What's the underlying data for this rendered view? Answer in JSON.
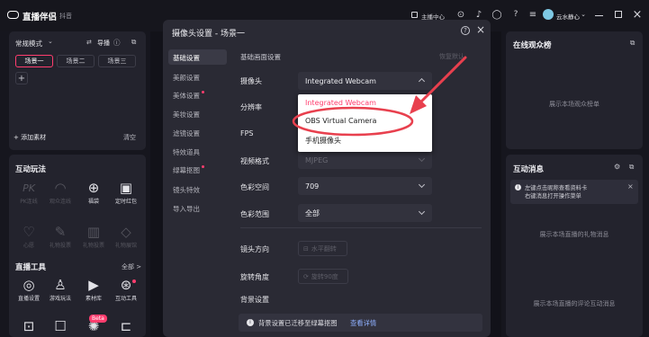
{
  "app": {
    "title": "直播伴侣",
    "subtitle": "抖音"
  },
  "titlebar": {
    "center_label": "主播中心",
    "user": "云水静心",
    "close": "×"
  },
  "left": {
    "mode": "常规模式",
    "guide": "导播",
    "scenes": [
      "场景一",
      "场景二",
      "场景三"
    ],
    "add": "+",
    "add_material": "+ 添加素材",
    "clear": "清空",
    "interactive_title": "互动玩法",
    "interactive": [
      {
        "label": "PK连线",
        "icon": "PK",
        "enabled": false
      },
      {
        "label": "观众连线",
        "icon": "◠",
        "enabled": false
      },
      {
        "label": "福袋",
        "icon": "⊕",
        "enabled": true
      },
      {
        "label": "定时红包",
        "icon": "▣",
        "enabled": true
      },
      {
        "label": "心愿",
        "icon": "♡",
        "enabled": false
      },
      {
        "label": "礼物投票",
        "icon": "✎",
        "enabled": false
      },
      {
        "label": "礼物投票",
        "icon": "▥",
        "enabled": false
      },
      {
        "label": "礼物展馆",
        "icon": "◇",
        "enabled": false
      }
    ],
    "tools_title": "直播工具",
    "tools_all": "全部 >",
    "tools": [
      {
        "label": "直播设置",
        "icon": "◎"
      },
      {
        "label": "游戏玩法",
        "icon": "♙"
      },
      {
        "label": "素材库",
        "icon": "▶"
      },
      {
        "label": "互动工具",
        "icon": "⊛"
      }
    ],
    "more_tools": [
      {
        "icon": "⊡"
      },
      {
        "icon": "☐"
      },
      {
        "icon": "✺",
        "badge": "Beta"
      },
      {
        "icon": "⊏"
      }
    ]
  },
  "right": {
    "audience_title": "在线观众榜",
    "audience_empty": "展示本场观众榜单",
    "messages_title": "互动消息",
    "notice_line1": "左键点击昵称查看资料卡",
    "notice_line2": "右键消息打开操作菜单",
    "notice_close": "×",
    "gift_empty": "展示本场直播的礼物消息",
    "comment_empty": "展示本场直播的评论互动消息"
  },
  "modal": {
    "title": "摄像头设置 - 场景一",
    "help": "?",
    "close": "×",
    "nav": [
      {
        "label": "基础设置",
        "active": true,
        "dot": false
      },
      {
        "label": "美颜设置",
        "active": false,
        "dot": false
      },
      {
        "label": "美体设置",
        "active": false,
        "dot": true
      },
      {
        "label": "美妆设置",
        "active": false,
        "dot": false
      },
      {
        "label": "滤镜设置",
        "active": false,
        "dot": false
      },
      {
        "label": "特效道具",
        "active": false,
        "dot": false
      },
      {
        "label": "绿幕抠图",
        "active": false,
        "dot": true
      },
      {
        "label": "镜头特效",
        "active": false,
        "dot": false
      },
      {
        "label": "导入导出",
        "active": false,
        "dot": false
      }
    ],
    "section": "基础画面设置",
    "section_right": "恢复默认",
    "camera_label": "摄像头",
    "camera_value": "Integrated Webcam",
    "resolution_label": "分辨率",
    "fps_label": "FPS",
    "format_label": "视频格式",
    "format_value": "MJPEG",
    "colorspace_label": "色彩空间",
    "colorspace_value": "709",
    "colorrange_label": "色彩范围",
    "colorrange_value": "全部",
    "direction_label": "镜头方向",
    "flip_button": "水平翻转",
    "rotate_label": "旋转角度",
    "rotate_button": "旋转90度",
    "bg_label": "背景设置",
    "bg_notice": "背景设置已迁移至绿幕抠图",
    "bg_link": "查看详情"
  },
  "dropdown": {
    "options": [
      "Integrated Webcam",
      "OBS Virtual Camera",
      "手机摄像头"
    ],
    "selected_index": 0,
    "highlighted_index": 1
  },
  "colors": {
    "accent": "#ff3d6e",
    "annotation": "#e8404e",
    "bg": "#16161e",
    "panel": "#23232d",
    "modal": "#2a2a34"
  }
}
